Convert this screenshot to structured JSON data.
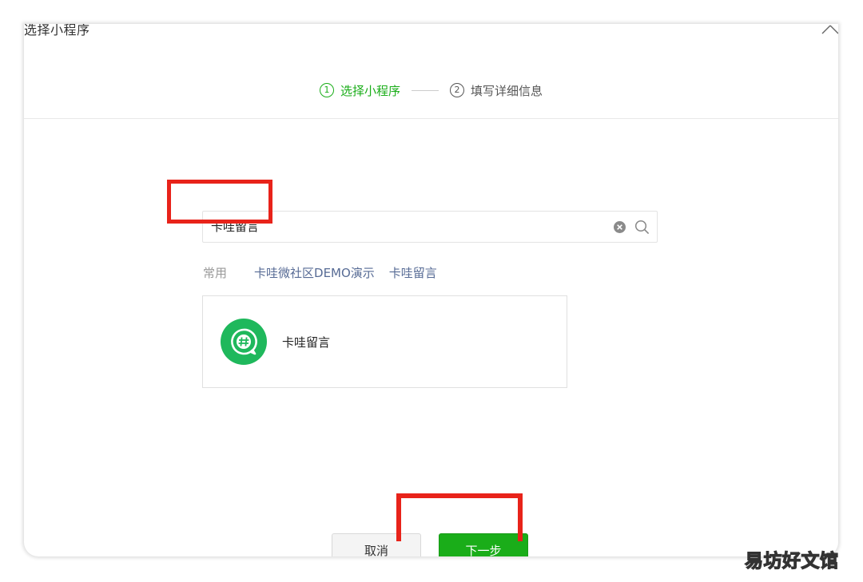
{
  "dialog": {
    "title": "选择小程序",
    "close_icon": "close-icon"
  },
  "stepper": {
    "steps": [
      {
        "num": "1",
        "label": "选择小程序",
        "state": "active"
      },
      {
        "num": "2",
        "label": "填写详细信息",
        "state": "inactive"
      }
    ]
  },
  "search": {
    "value": "卡哇留言",
    "clear_icon": "clear-icon",
    "search_icon": "search-icon"
  },
  "recent": {
    "label": "常用",
    "items": [
      "卡哇微社区DEMO演示",
      "卡哇留言"
    ]
  },
  "results": [
    {
      "name": "卡哇留言",
      "icon": "hashtag-chat-icon"
    }
  ],
  "footer": {
    "cancel_label": "取消",
    "next_label": "下一步"
  },
  "watermark": "易坊好文馆",
  "colors": {
    "accent": "#1aad19",
    "link": "#576b95",
    "highlight": "#e8231a"
  }
}
